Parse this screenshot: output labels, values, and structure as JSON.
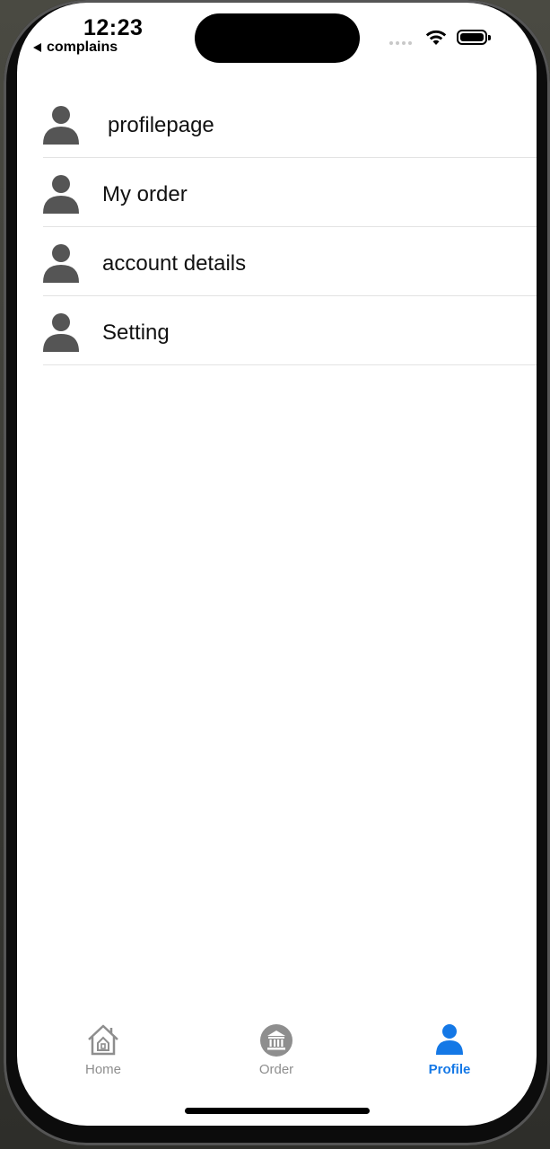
{
  "status_bar": {
    "time": "12:23",
    "back_app": "complains"
  },
  "menu": {
    "items": [
      {
        "label": "profilepage",
        "icon": "person-icon"
      },
      {
        "label": "My order",
        "icon": "person-icon"
      },
      {
        "label": "account details",
        "icon": "person-icon"
      },
      {
        "label": "Setting",
        "icon": "person-icon"
      }
    ]
  },
  "tab_bar": {
    "tabs": [
      {
        "label": "Home",
        "icon": "home-icon",
        "active": false
      },
      {
        "label": "Order",
        "icon": "bank-icon",
        "active": false
      },
      {
        "label": "Profile",
        "icon": "person-icon",
        "active": true
      }
    ]
  },
  "colors": {
    "accent": "#1478e6",
    "inactive": "#8e8e8e",
    "icon_gray": "#555555"
  }
}
